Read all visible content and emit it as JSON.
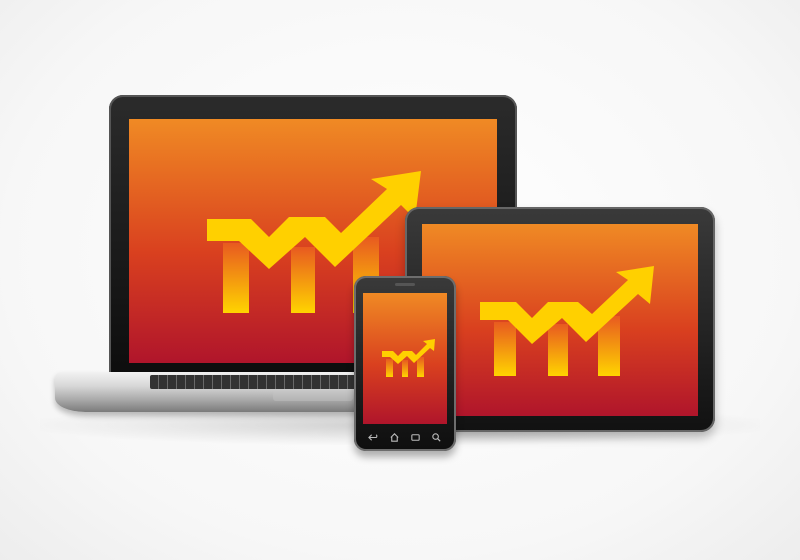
{
  "scene": {
    "devices": [
      "laptop",
      "tablet",
      "phone"
    ],
    "logo_icon": "mm-rising-arrow-icon",
    "phone_nav_icons": [
      "back-icon",
      "home-icon",
      "menu-icon",
      "search-icon"
    ]
  },
  "colors": {
    "screen_top": "#f08a24",
    "screen_mid": "#d9401f",
    "screen_bottom": "#b0152b",
    "logo_light": "#ffd400",
    "logo_dark": "#f4a11c",
    "device_black": "#111111",
    "aluminum": "#c8c8c8"
  }
}
